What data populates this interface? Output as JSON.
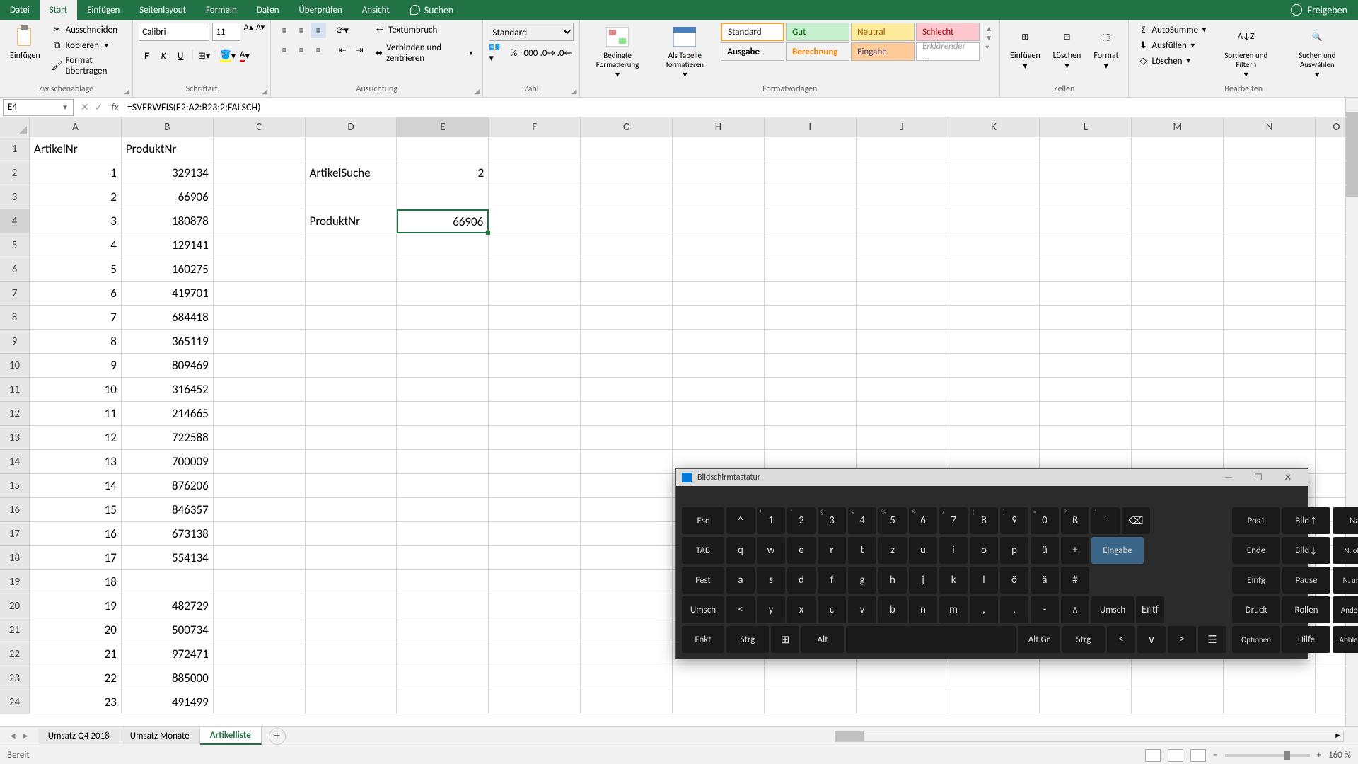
{
  "title_bar": {
    "tabs": [
      "Datei",
      "Start",
      "Einfügen",
      "Seitenlayout",
      "Formeln",
      "Daten",
      "Überprüfen",
      "Ansicht"
    ],
    "active_tab_index": 1,
    "search_placeholder": "Suchen",
    "share_label": "Freigeben"
  },
  "ribbon": {
    "clipboard": {
      "paste": "Einfügen",
      "cut": "Ausschneiden",
      "copy": "Kopieren",
      "format_painter": "Format übertragen",
      "group_label": "Zwischenablage"
    },
    "font": {
      "name": "Calibri",
      "size": "11",
      "group_label": "Schriftart"
    },
    "alignment": {
      "wrap": "Textumbruch",
      "merge": "Verbinden und zentrieren",
      "group_label": "Ausrichtung"
    },
    "number": {
      "format": "Standard",
      "group_label": "Zahl"
    },
    "styles": {
      "cond": "Bedingte Formatierung",
      "table": "Als Tabelle formatieren",
      "standard": "Standard",
      "gut": "Gut",
      "neutral": "Neutral",
      "schlecht": "Schlecht",
      "ausgabe": "Ausgabe",
      "berechnung": "Berechnung",
      "eingabe": "Eingabe",
      "erklaerender": "Erklärender ...",
      "group_label": "Formatvorlagen"
    },
    "cells": {
      "insert": "Einfügen",
      "delete": "Löschen",
      "format": "Format",
      "group_label": "Zellen"
    },
    "editing": {
      "autosum": "AutoSumme",
      "fill": "Ausfüllen",
      "clear": "Löschen",
      "sort": "Sortieren und Filtern",
      "find": "Suchen und Auswählen",
      "group_label": "Bearbeiten"
    }
  },
  "formula_bar": {
    "cell_ref": "E4",
    "formula": "=SVERWEIS(E2;A2:B23;2;FALSCH)"
  },
  "columns": [
    "A",
    "B",
    "C",
    "D",
    "E",
    "F",
    "G",
    "H",
    "I",
    "J",
    "K",
    "L",
    "M",
    "N",
    "O"
  ],
  "chart_data": {
    "type": "table",
    "headers": {
      "A": "ArtikelNr",
      "B": "ProduktNr"
    },
    "rows_ab": [
      [
        1,
        329134
      ],
      [
        2,
        66906
      ],
      [
        3,
        180878
      ],
      [
        4,
        129141
      ],
      [
        5,
        160275
      ],
      [
        6,
        419701
      ],
      [
        7,
        684418
      ],
      [
        8,
        365119
      ],
      [
        9,
        809469
      ],
      [
        10,
        316452
      ],
      [
        11,
        214665
      ],
      [
        12,
        722588
      ],
      [
        13,
        700009
      ],
      [
        14,
        876206
      ],
      [
        15,
        846357
      ],
      [
        16,
        673138
      ],
      [
        17,
        554134
      ],
      [
        18,
        null
      ],
      [
        19,
        482729
      ],
      [
        20,
        500734
      ],
      [
        21,
        972471
      ],
      [
        22,
        885000
      ],
      [
        23,
        491499
      ]
    ],
    "lookup": {
      "D2": "ArtikelSuche",
      "E2": 2,
      "D4": "ProduktNr",
      "E4": 66906
    }
  },
  "selected_cell": "E4",
  "sheet_tabs": {
    "tabs": [
      "Umsatz Q4 2018",
      "Umsatz Monate",
      "Artikelliste"
    ],
    "active_index": 2
  },
  "status_bar": {
    "ready": "Bereit",
    "zoom": "160 %"
  },
  "osk": {
    "title": "Bildschirmtastatur",
    "row1": [
      "Esc",
      "^",
      "1",
      "2",
      "3",
      "4",
      "5",
      "6",
      "7",
      "8",
      "9",
      "0",
      "ß",
      "´",
      "⌫"
    ],
    "row1_sub": [
      "",
      "",
      "!",
      "\"",
      "§",
      "$",
      "%",
      "&",
      "/",
      "(",
      ")",
      "=",
      "?",
      "`",
      ""
    ],
    "row2": [
      "TAB",
      "q",
      "w",
      "e",
      "r",
      "t",
      "z",
      "u",
      "i",
      "o",
      "p",
      "ü",
      "+",
      "Eingabe"
    ],
    "row3": [
      "Fest",
      "a",
      "s",
      "d",
      "f",
      "g",
      "h",
      "j",
      "k",
      "l",
      "ö",
      "ä",
      "#"
    ],
    "row4": [
      "Umsch",
      "<",
      "y",
      "x",
      "c",
      "v",
      "b",
      "n",
      "m",
      ",",
      ".",
      "-",
      "∧",
      "Umsch",
      "Entf"
    ],
    "row5": [
      "Fnkt",
      "Strg",
      "⊞",
      "Alt",
      "",
      "Alt Gr",
      "Strg",
      "<",
      "∨",
      ">",
      "☰"
    ],
    "side": [
      [
        "Pos1",
        "Bild↑",
        "Nav"
      ],
      [
        "Ende",
        "Bild↓",
        "N. oben"
      ],
      [
        "Einfg",
        "Pause",
        "N. unten"
      ],
      [
        "Druck",
        "Rollen",
        "Andocken"
      ],
      [
        "Optionen",
        "Hilfe",
        "Abblenden"
      ]
    ]
  }
}
